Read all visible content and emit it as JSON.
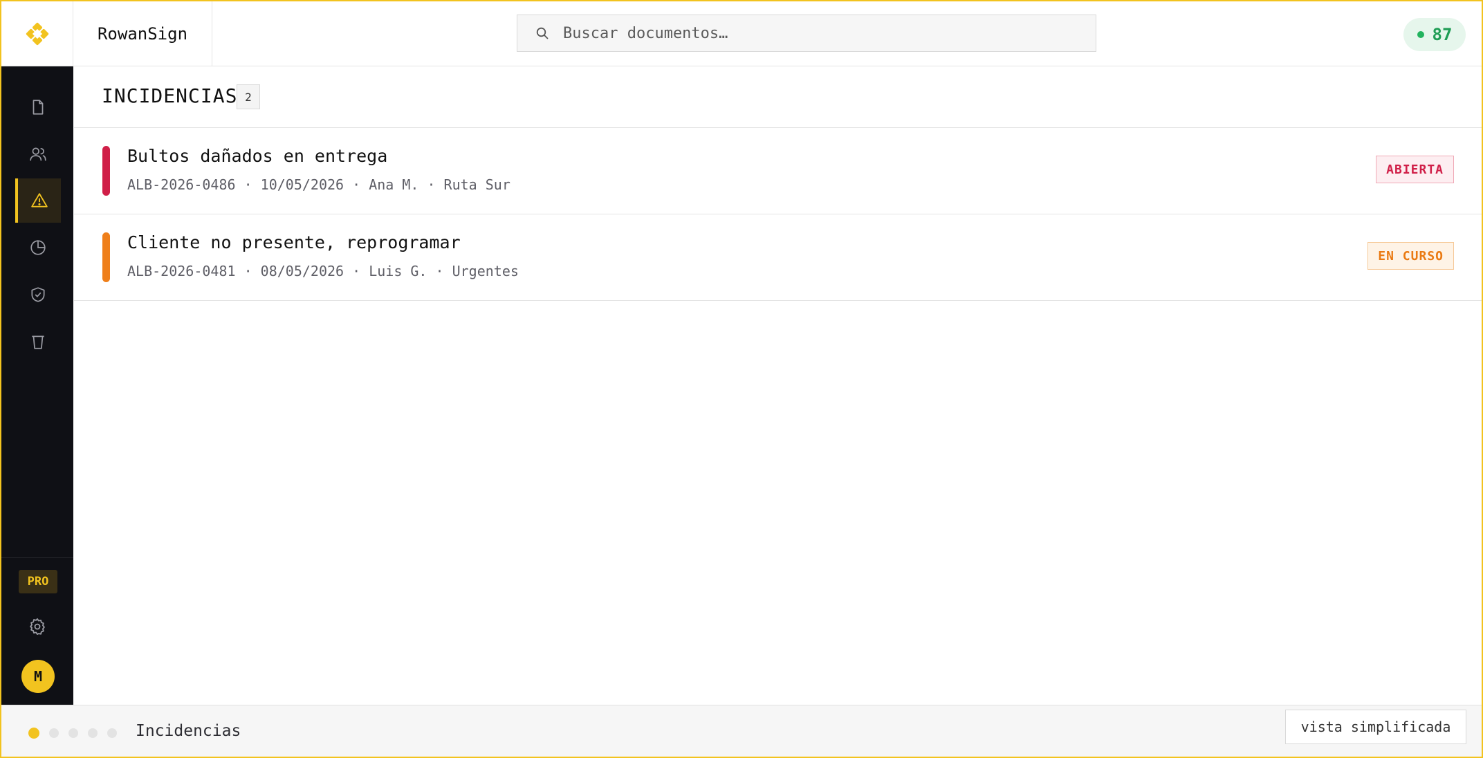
{
  "app": {
    "brand": "RowanSign",
    "score": "87"
  },
  "search": {
    "placeholder": "Buscar documentos…"
  },
  "sidebar": {
    "items": [
      {
        "icon": "document-icon"
      },
      {
        "icon": "users-icon"
      },
      {
        "icon": "warning-icon",
        "active": true
      },
      {
        "icon": "pie-chart-icon"
      },
      {
        "icon": "shield-check-icon"
      },
      {
        "icon": "trash-icon"
      }
    ],
    "plan_badge": "PRO",
    "avatar_initial": "M"
  },
  "section": {
    "title": "INCIDENCIAS",
    "count": "2"
  },
  "incidents": [
    {
      "title": "Bultos dañados en entrega",
      "meta": "ALB-2026-0486 · 10/05/2026 · Ana M. · Ruta Sur",
      "status": "ABIERTA",
      "color": "#d01f48"
    },
    {
      "title": "Cliente no presente, reprogramar",
      "meta": "ALB-2026-0481 · 08/05/2026 · Luis G. · Urgentes",
      "status": "EN CURSO",
      "color": "#ef7f1a"
    }
  ],
  "footer": {
    "label": "Incidencias",
    "simple_view": "vista simplificada",
    "steps_total": 5,
    "step_active": 1
  },
  "colors": {
    "accent": "#f2c31f",
    "sidebar_bg": "#0f1015",
    "success": "#1f9d55"
  }
}
